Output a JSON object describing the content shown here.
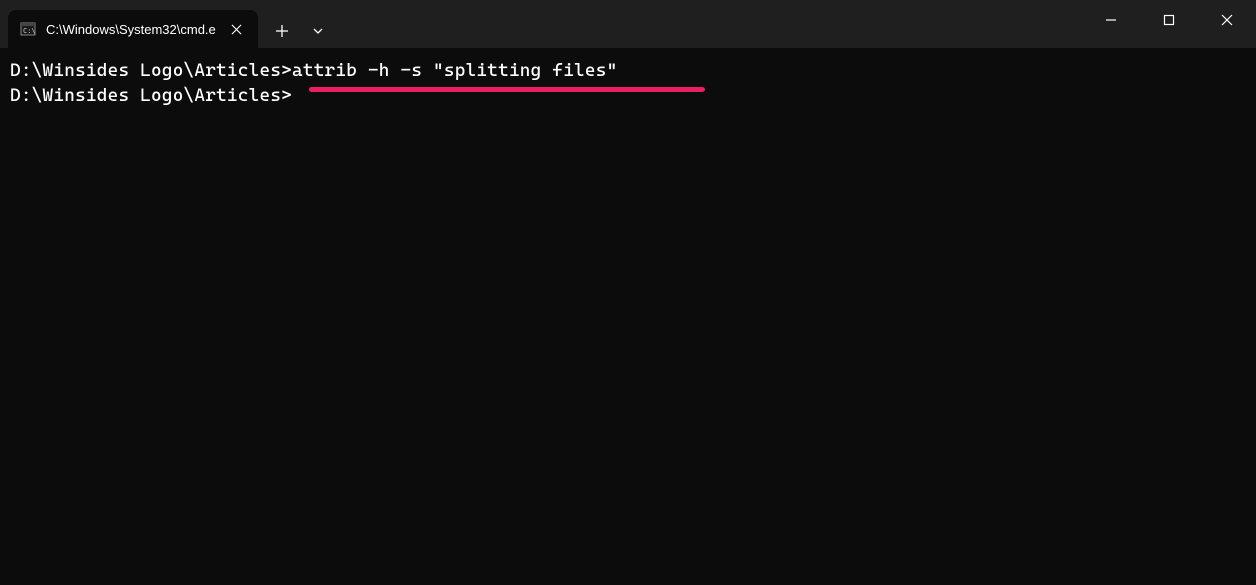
{
  "tab": {
    "title": "C:\\Windows\\System32\\cmd.e"
  },
  "terminal": {
    "lines": [
      "D:\\Winsides Logo\\Articles>attrib -h -s \"splitting files\"",
      "",
      "D:\\Winsides Logo\\Articles>"
    ]
  }
}
